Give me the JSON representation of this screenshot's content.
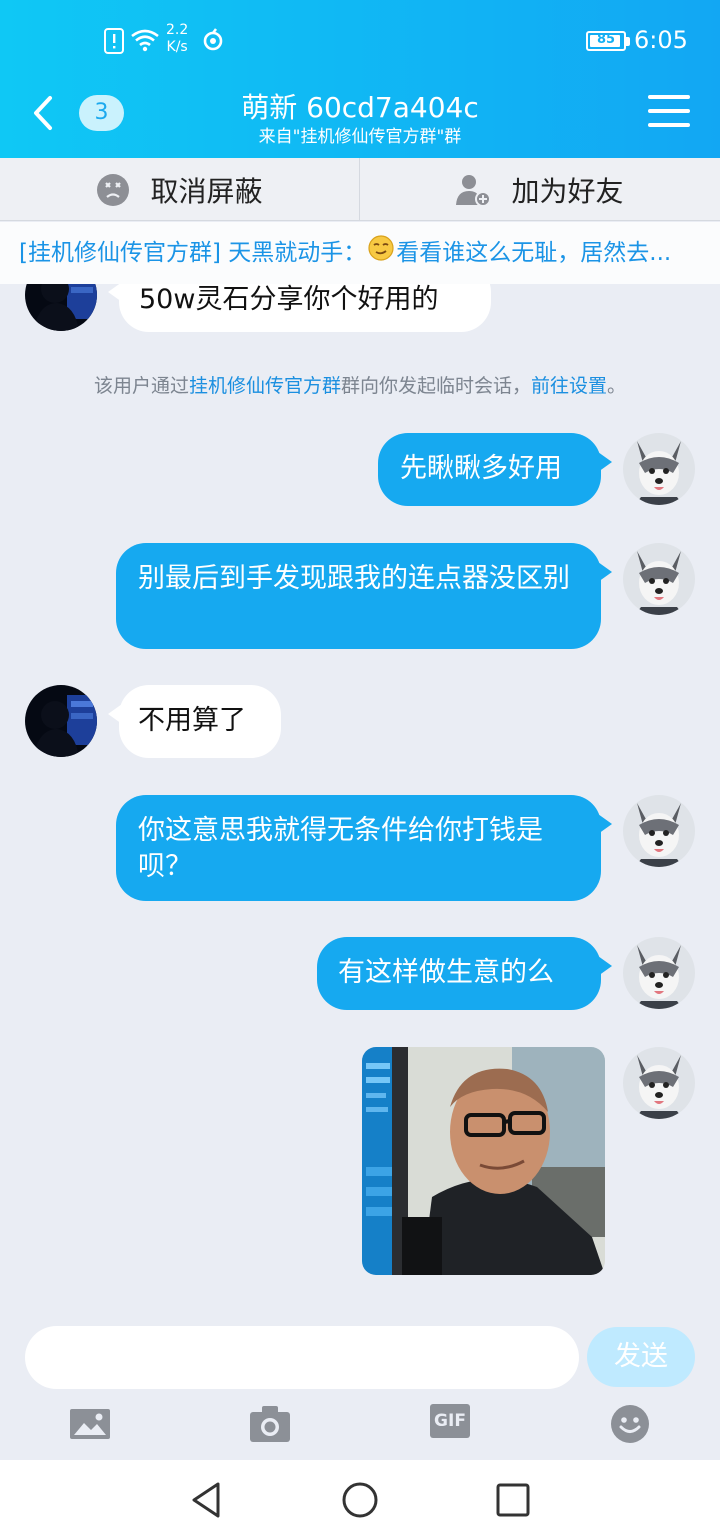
{
  "status_bar": {
    "speed_value": "2.2",
    "speed_unit": "K/s",
    "battery": "85",
    "time": "6:05",
    "icons": [
      "alert-icon",
      "wifi-icon",
      "hotspot-icon",
      "battery-icon"
    ]
  },
  "header": {
    "unread_count": "3",
    "title": "萌新 60cd7a404c",
    "subtitle": "来自\"挂机修仙传官方群\"群",
    "gradient": [
      "#0fc8f5",
      "#12a7f3"
    ]
  },
  "actions": {
    "unblock": "取消屏蔽",
    "add_friend": "加为好友"
  },
  "notice": {
    "group": "[挂机修仙传官方群]",
    "sender": "天黑就动手：",
    "text": "看看谁这么无耻，居然去..."
  },
  "system_message": {
    "prefix": "该用户通过",
    "group_link": "挂机修仙传官方群",
    "middle": "群向你发起临时会话，",
    "settings_link": "前往设置",
    "suffix": "。"
  },
  "messages": [
    {
      "side": "left",
      "text": "50w灵石分享你个好用的"
    },
    {
      "side": "right",
      "text": "先瞅瞅多好用"
    },
    {
      "side": "right",
      "text": "别最后到手发现跟我的连点器没区别"
    },
    {
      "side": "left",
      "text": "不用算了"
    },
    {
      "side": "right",
      "text": "你这意思我就得无条件给你打钱是呗？"
    },
    {
      "side": "right",
      "text": "有这样做生意的么"
    },
    {
      "side": "right",
      "type": "image",
      "text": ""
    }
  ],
  "input": {
    "placeholder": "",
    "send_label": "发送",
    "tools": [
      "image-icon",
      "camera-icon",
      "gif-icon",
      "emoji-icon"
    ],
    "gif_label": "GIF"
  },
  "colors": {
    "accent": "#16a9f0",
    "link": "#1b8fe0",
    "background": "#eaedf4"
  }
}
